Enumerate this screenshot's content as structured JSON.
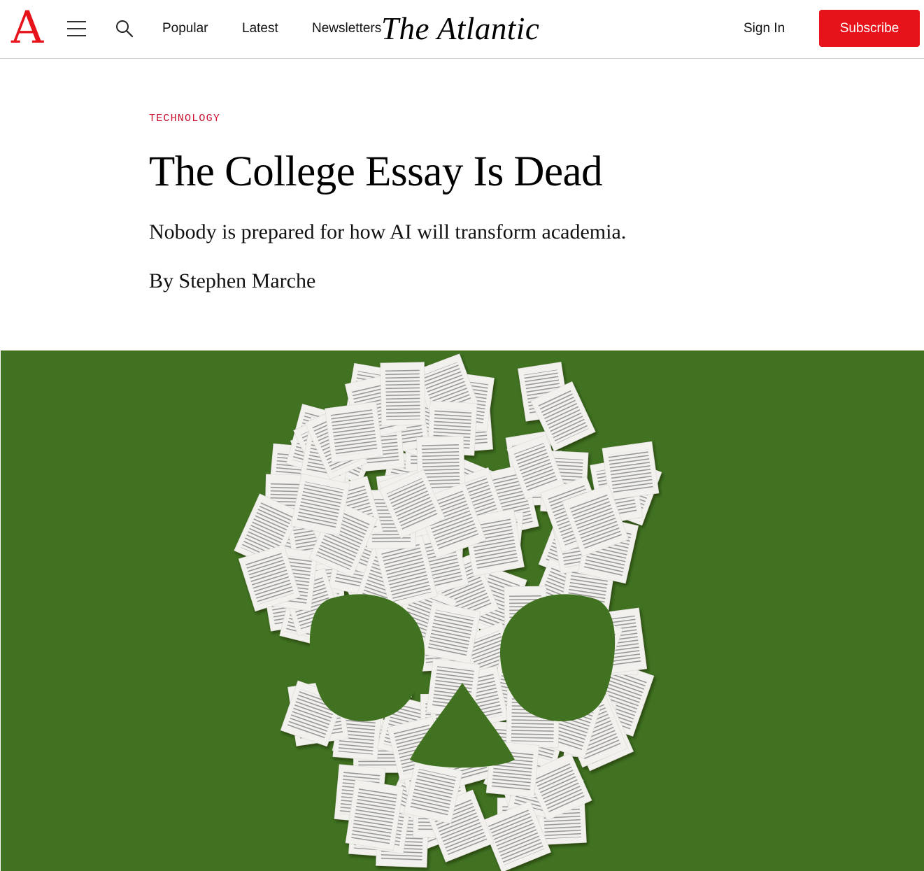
{
  "header": {
    "logo_letter": "A",
    "nav": {
      "popular": "Popular",
      "latest": "Latest",
      "newsletters": "Newsletters"
    },
    "wordmark": "The Atlantic",
    "sign_in": "Sign In",
    "subscribe": "Subscribe",
    "brand_color": "#e7131a",
    "icons": [
      "menu-icon",
      "search-icon"
    ]
  },
  "article": {
    "section": "TECHNOLOGY",
    "section_color": "#c8102e",
    "headline": "The College Essay Is Dead",
    "dek": "Nobody is prepared for how AI will transform academia.",
    "byline_prefix": "By ",
    "author": "Stephen Marche"
  },
  "lead_image": {
    "subject": "skull made of essay pages",
    "background_color": "#417221"
  }
}
